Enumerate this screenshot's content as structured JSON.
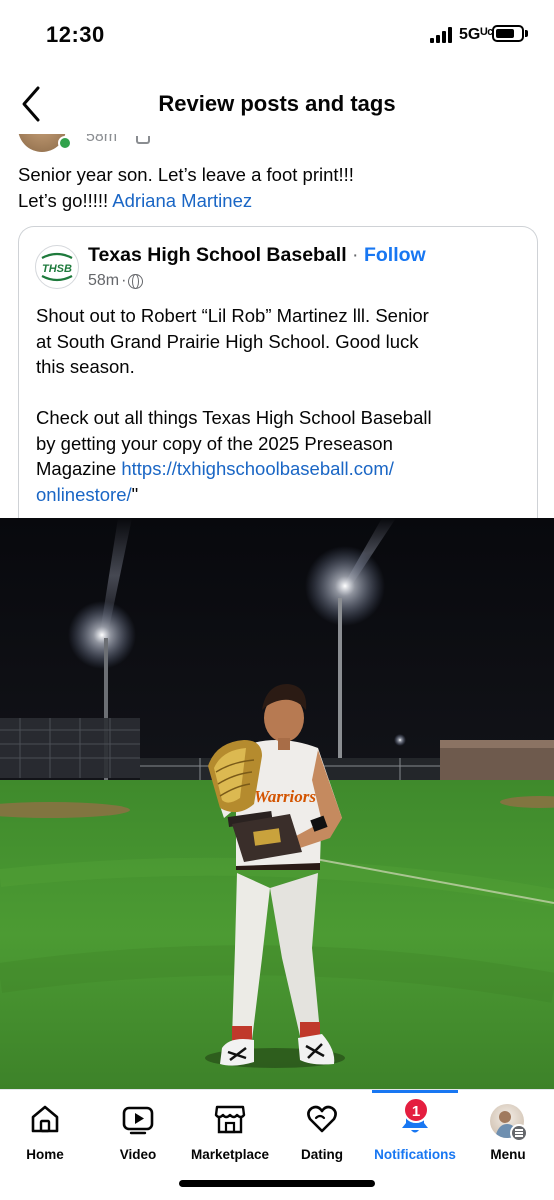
{
  "status_bar": {
    "time": "12:30",
    "network": "5Gᵁᶜ",
    "signal_bars": 4,
    "battery_level": 0.65
  },
  "header": {
    "title": "Review posts and tags",
    "back_icon": "chevron-left-icon"
  },
  "post": {
    "text_line1": "Senior year son. Let’s leave a foot print!!!",
    "text_line2_prefix": "Let’s go!!!!! ",
    "tagged_person": "Adriana Martinez",
    "online_status_color": "#31a24c"
  },
  "shared_post": {
    "page_name": "Texas High School Baseball",
    "separator": " · ",
    "follow_label": "Follow",
    "time": "58m",
    "dot": " · ",
    "privacy_icon": "globe-icon",
    "logo_text": "THSB",
    "body_lines": [
      "Shout out to Robert “Lil Rob” Martinez lll. Senior",
      "at South Grand Prairie High School.  Good luck",
      "this season."
    ],
    "body2_lines": [
      "Check out all things Texas High School Baseball",
      "by getting your copy of the 2025 Preseason"
    ],
    "body2_last_prefix": "Magazine ",
    "url_part1": "https://txhighschoolbaseball.com/",
    "url_part2": "onlinestore/",
    "url_suffix": "\""
  },
  "photo": {
    "jersey_text": "Warriors"
  },
  "tabs": [
    {
      "label": "Home",
      "icon": "home-icon",
      "active": false
    },
    {
      "label": "Video",
      "icon": "video-play-icon",
      "active": false
    },
    {
      "label": "Marketplace",
      "icon": "marketplace-shop-icon",
      "active": false
    },
    {
      "label": "Dating",
      "icon": "dating-heart-icon",
      "active": false
    },
    {
      "label": "Notifications",
      "icon": "bell-icon",
      "active": true
    },
    {
      "label": "Menu",
      "icon": "profile-avatar-icon",
      "active": false
    }
  ],
  "notifications_badge": "1",
  "colors": {
    "accent": "#1877f2",
    "link": "#1a66c5",
    "badge": "#e41e3f",
    "logo_green": "#1e7a3c"
  }
}
